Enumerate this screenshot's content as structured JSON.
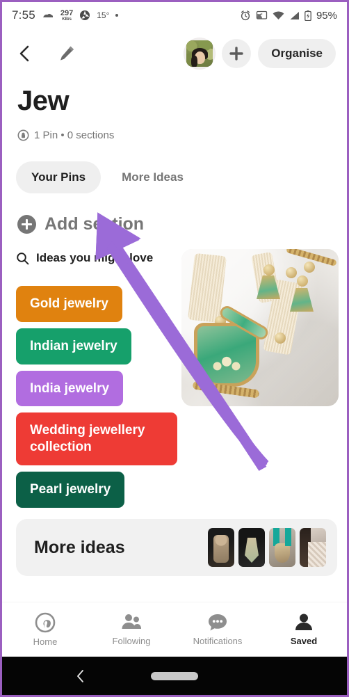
{
  "status_bar": {
    "time": "7:55",
    "weather_icon": "cloud-icon",
    "network_speed_value": "297",
    "network_speed_unit": "KB/s",
    "aperture_icon": "aperture-icon",
    "temperature": "15°",
    "dot_indicator": "•",
    "alarm_icon": "alarm-clock-icon",
    "cast_icon": "cast-icon",
    "wifi_icon": "wifi-icon",
    "signal_icon": "cell-signal-icon",
    "battery_icon": "battery-charging-icon",
    "battery_level": "95%"
  },
  "app_bar": {
    "back_icon": "chevron-left-icon",
    "edit_icon": "pencil-icon",
    "avatar": "user-avatar",
    "add_icon": "plus-icon",
    "organise_label": "Organise"
  },
  "board": {
    "title": "Jew",
    "privacy_icon": "lock-icon",
    "meta": "1 Pin • 0 sections"
  },
  "tabs": [
    {
      "label": "Your Pins",
      "active": true
    },
    {
      "label": "More Ideas",
      "active": false
    }
  ],
  "add_section": {
    "icon": "plus-circle-icon",
    "label": "Add section"
  },
  "ideas": {
    "search_icon": "search-icon",
    "heading": "Ideas you might love",
    "chips": [
      {
        "label": "Gold jewelry",
        "color": "#E0820F"
      },
      {
        "label": "Indian jewelry",
        "color": "#16A06B"
      },
      {
        "label": "India jewelry",
        "color": "#B16DE0"
      },
      {
        "label": "Wedding jewellery collection",
        "color": "#EE3B35"
      },
      {
        "label": "Pearl jewelry",
        "color": "#0C6047"
      }
    ]
  },
  "pin": {
    "name": "green-gold-jewellery-set-pin"
  },
  "more_ideas": {
    "label": "More ideas",
    "thumbnails": [
      "thumbnail-jewellery-1",
      "thumbnail-jewellery-2",
      "thumbnail-jewellery-3",
      "thumbnail-jewellery-4"
    ]
  },
  "bottom_nav": [
    {
      "label": "Home",
      "icon": "pinterest-icon",
      "active": false
    },
    {
      "label": "Following",
      "icon": "people-icon",
      "active": false
    },
    {
      "label": "Notifications",
      "icon": "chat-bubble-icon",
      "active": false
    },
    {
      "label": "Saved",
      "icon": "person-icon",
      "active": true
    }
  ],
  "android_nav": {
    "back_icon": "android-back-icon",
    "home_pill": "android-home-pill"
  },
  "annotation": {
    "arrow_color": "#9B6BD8",
    "target": "add-section"
  }
}
